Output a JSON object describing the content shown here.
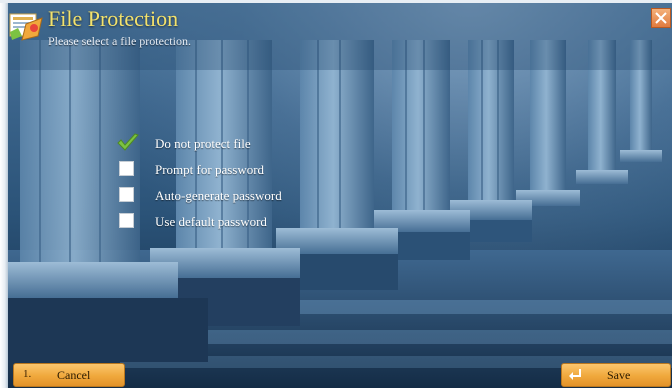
{
  "header": {
    "title": "File Protection",
    "subtitle": "Please select a file protection."
  },
  "icons": {
    "app": "file-protection-app-icon",
    "close": "close-icon",
    "check": "checkmark-icon",
    "enter": "enter-key-icon"
  },
  "options": [
    {
      "label": "Do not protect file",
      "checked": true
    },
    {
      "label": "Prompt for password",
      "checked": false
    },
    {
      "label": "Auto-generate password",
      "checked": false
    },
    {
      "label": "Use default password",
      "checked": false
    }
  ],
  "footer": {
    "cancel_key": "1.",
    "cancel_label": "Cancel",
    "save_label": "Save"
  },
  "colors": {
    "title": "#f3e26c",
    "button": "#f0a83c",
    "check": "#7cc242",
    "background": "#2b5378"
  }
}
